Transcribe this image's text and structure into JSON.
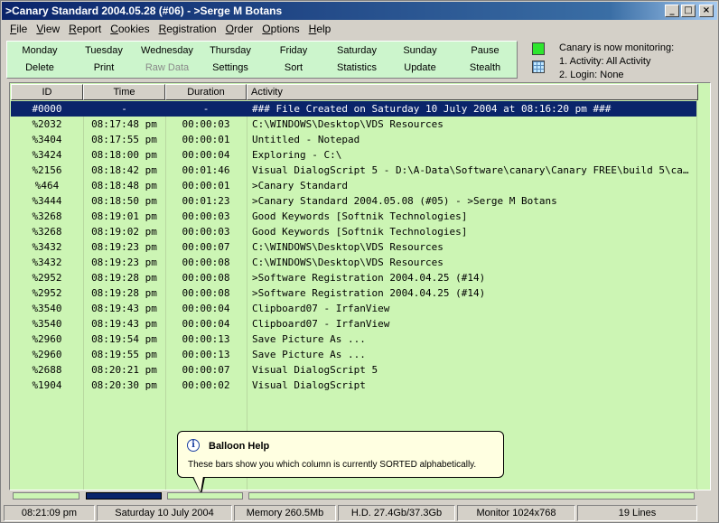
{
  "window": {
    "title": ">Canary Standard 2004.05.28 (#06) - >Serge M Botans",
    "minimize_glyph": "_",
    "maximize_glyph": "□",
    "close_glyph": "×"
  },
  "menu": [
    {
      "accel": "F",
      "rest": "ile"
    },
    {
      "accel": "V",
      "rest": "iew"
    },
    {
      "accel": "R",
      "rest": "eport"
    },
    {
      "accel": "C",
      "rest": "ookies"
    },
    {
      "accel": "R",
      "rest": "egistration"
    },
    {
      "accel": "O",
      "rest": "rder"
    },
    {
      "accel": "O",
      "rest": "ptions"
    },
    {
      "accel": "H",
      "rest": "elp"
    }
  ],
  "toolbar": {
    "row1": [
      "Monday",
      "Tuesday",
      "Wednesday",
      "Thursday",
      "Friday",
      "Saturday",
      "Sunday",
      "Pause"
    ],
    "row2": [
      "Delete",
      "Print",
      "Raw Data",
      "Settings",
      "Sort",
      "Statistics",
      "Update",
      "Stealth"
    ],
    "disabled": [
      "Raw Data"
    ]
  },
  "monitor": {
    "line1": "Canary is now monitoring:",
    "line2": "1. Activity: All Activity",
    "line3": "2. Login: None",
    "active_color": "#2ee62e"
  },
  "table": {
    "columns": [
      "ID",
      "Time",
      "Duration",
      "Activity"
    ],
    "rows": [
      [
        "#0000",
        "-",
        "-",
        "### File Created on Saturday 10 July 2004 at 08:16:20 pm ###"
      ],
      [
        "%2032",
        "08:17:48 pm",
        "00:00:03",
        "C:\\WINDOWS\\Desktop\\VDS Resources"
      ],
      [
        "%3404",
        "08:17:55 pm",
        "00:00:01",
        "Untitled - Notepad"
      ],
      [
        "%3424",
        "08:18:00 pm",
        "00:00:04",
        "Exploring - C:\\"
      ],
      [
        "%2156",
        "08:18:42 pm",
        "00:01:46",
        "Visual DialogScript 5 - D:\\A-Data\\Software\\canary\\Canary FREE\\build 5\\canary\\ca..."
      ],
      [
        "%464",
        "08:18:48 pm",
        "00:00:01",
        ">Canary Standard"
      ],
      [
        "%3444",
        "08:18:50 pm",
        "00:01:23",
        ">Canary Standard 2004.05.08 (#05) - >Serge M Botans"
      ],
      [
        "%3268",
        "08:19:01 pm",
        "00:00:03",
        "Good Keywords [Softnik Technologies]"
      ],
      [
        "%3268",
        "08:19:02 pm",
        "00:00:03",
        "Good Keywords [Softnik Technologies]"
      ],
      [
        "%3432",
        "08:19:23 pm",
        "00:00:07",
        "C:\\WINDOWS\\Desktop\\VDS Resources"
      ],
      [
        "%3432",
        "08:19:23 pm",
        "00:00:08",
        "C:\\WINDOWS\\Desktop\\VDS Resources"
      ],
      [
        "%2952",
        "08:19:28 pm",
        "00:00:08",
        ">Software Registration 2004.04.25 (#14)"
      ],
      [
        "%2952",
        "08:19:28 pm",
        "00:00:08",
        ">Software Registration 2004.04.25 (#14)"
      ],
      [
        "%3540",
        "08:19:43 pm",
        "00:00:04",
        "Clipboard07 - IrfanView"
      ],
      [
        "%3540",
        "08:19:43 pm",
        "00:00:04",
        "Clipboard07 - IrfanView"
      ],
      [
        "%2960",
        "08:19:54 pm",
        "00:00:13",
        "Save Picture As ..."
      ],
      [
        "%2960",
        "08:19:55 pm",
        "00:00:13",
        "Save Picture As ..."
      ],
      [
        "%2688",
        "08:20:21 pm",
        "00:00:07",
        "Visual DialogScript 5"
      ],
      [
        "%1904",
        "08:20:30 pm",
        "00:00:02",
        "Visual DialogScript"
      ]
    ],
    "selected_row": 0,
    "empty_rows": 7
  },
  "balloon": {
    "title": "Balloon Help",
    "text": "These bars show you which column is currently SORTED alphabetically.",
    "icon_glyph": "i"
  },
  "sort_indicator": {
    "active_column": "Time"
  },
  "statusbar": {
    "time": "08:21:09 pm",
    "date": "Saturday 10 July 2004",
    "memory": "Memory 260.5Mb",
    "disk": "H.D. 27.4Gb/37.3Gb",
    "monitor": "Monitor 1024x768",
    "lines": "19 Lines"
  },
  "colors": {
    "title_start": "#0a246a",
    "title_end": "#a6caf0",
    "list_bg": "#ccf5b4",
    "toolbar_bg": "#ccf5cc",
    "selection": "#0a246a",
    "balloon_bg": "#ffffe1"
  }
}
